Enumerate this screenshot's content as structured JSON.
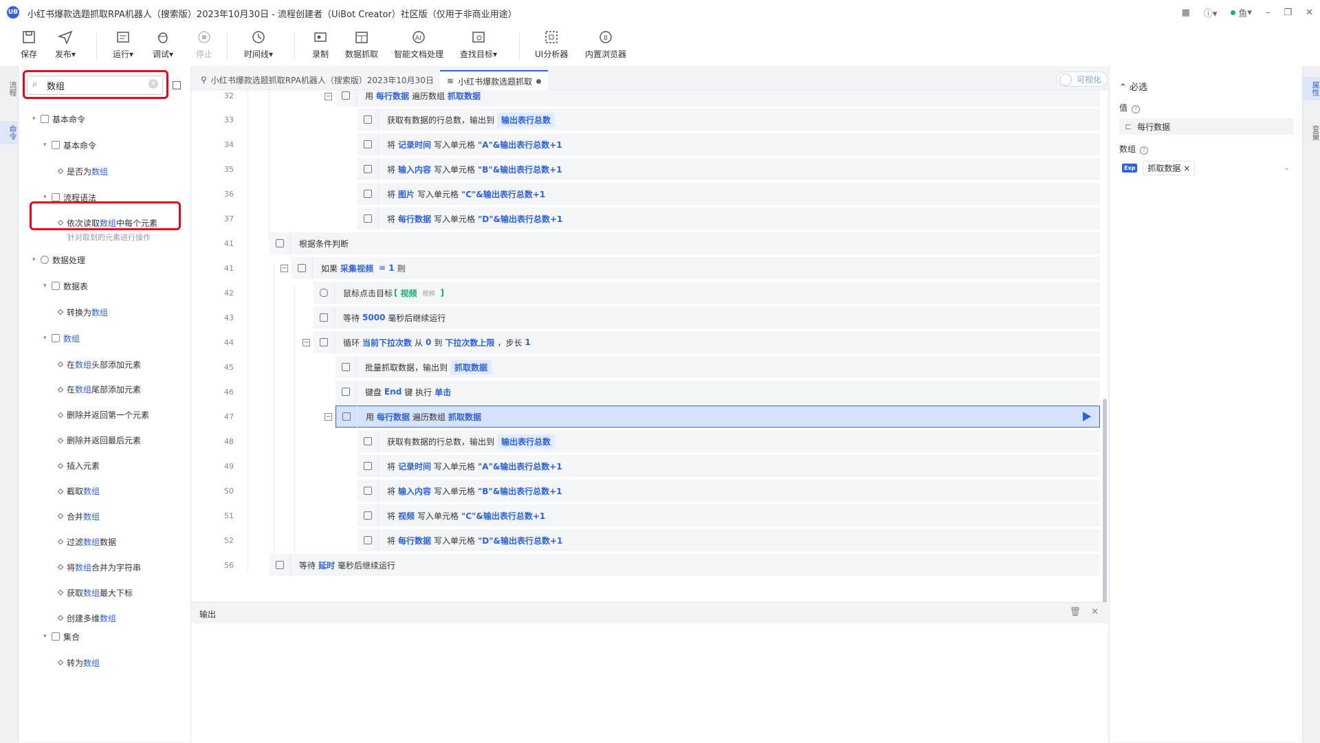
{
  "window": {
    "logo": "UB",
    "title": "小红书爆款选题抓取RPA机器人（搜索版）2023年10月30日 - 流程创建者（UiBot Creator）社区版（仅用于非商业用途）",
    "user": "鱼",
    "controls": {
      "minimize": "–",
      "restore": "❐",
      "close": "✕"
    }
  },
  "toolbar": {
    "save": "保存",
    "publish": "发布",
    "run": "运行",
    "debug": "调试",
    "stop": "停止",
    "timeline": "时间线",
    "record": "录制",
    "data_grab": "数据抓取",
    "smart_doc": "智能文档处理",
    "find_target": "查找目标",
    "ui_analyzer": "UI分析器",
    "browser": "内置浏览器",
    "dropdown_marker": "▾"
  },
  "left_rail": {
    "tab1": "流程",
    "tab2": "命令"
  },
  "search": {
    "value": "数组",
    "clear": "×"
  },
  "tree": {
    "basic_commands": "基本命令",
    "basic_commands_sub": "基本命令",
    "is_array_prefix": "是否为",
    "keyword": "数组",
    "flow_syntax": "流程语法",
    "foreach_prefix": "依次读取",
    "foreach_suffix": "中每个元素",
    "foreach_hint": "针对取到的元素进行操作",
    "data_processing": "数据处理",
    "datatable": "数据表",
    "convert_prefix": "转换为",
    "array_group": "数组",
    "items": [
      {
        "pre": "在",
        "post": "头部添加元素"
      },
      {
        "pre": "在",
        "post": "尾部添加元素"
      },
      {
        "pre": "删除并返回第一个元素",
        "post": ""
      },
      {
        "pre": "删除并返回最后元素",
        "post": ""
      },
      {
        "pre": "插入元素",
        "post": ""
      },
      {
        "pre": "截取",
        "post": ""
      },
      {
        "pre": "合并",
        "post": ""
      },
      {
        "pre": "过滤",
        "post": "数据"
      },
      {
        "pre": "将",
        "post": "合并为字符串"
      },
      {
        "pre": "获取",
        "post": "最大下标"
      },
      {
        "pre": "创建多维",
        "post": ""
      }
    ],
    "collection": "集合",
    "to_array_prefix": "转为"
  },
  "tabs": {
    "main_flow": "小红书爆款选题抓取RPA机器人（搜索版）2023年10月30日",
    "sub_flow": "小红书爆款选题抓取",
    "visualize": "可视化"
  },
  "code": {
    "lines": [
      "32",
      "33",
      "34",
      "35",
      "36",
      "37",
      "41",
      "41",
      "42",
      "43",
      "44",
      "45",
      "46",
      "47",
      "48",
      "49",
      "50",
      "51",
      "52",
      "56"
    ],
    "use": "用",
    "traverse": "遍历数组",
    "each_row": "每行数据",
    "grab_data": "抓取数据",
    "get_rows": "获取有数据的行总数，输出到",
    "total_rows": "输出表行总数",
    "write_prefix": "将",
    "write_mid": "写入单元格",
    "rec_time": "记录时间",
    "input_content": "输入内容",
    "image": "图片",
    "video_var": "视频",
    "cell_a": "\"A\"&输出表行总数+1",
    "cell_b": "\"B\"&输出表行总数+1",
    "cell_c": "\"C\"&输出表行总数+1",
    "cell_d": "\"D\"&输出表行总数+1",
    "cond_judge": "根据条件判断",
    "if_kw": "如果",
    "collect_video": "采集视频",
    "eq_one": "= 1",
    "then_kw": "则",
    "mouse_click": "鼠标点击目标",
    "bracket_open": "[",
    "target_video": "视频",
    "target_small": "视频",
    "bracket_close": "]",
    "wait_kw": "等待",
    "wait_ms": "5000",
    "wait_suffix": "毫秒后继续运行",
    "loop_kw": "循环",
    "cur_scroll": "当前下拉次数",
    "from_kw": "从",
    "zero": "0",
    "to_kw": "到",
    "scroll_max": "下拉次数上限",
    "step_kw": "，步长",
    "one": "1",
    "batch_grab": "批量抓取数据，输出到",
    "key_kw": "键盘",
    "end_key": "End",
    "key_exec": "键 执行",
    "single_click": "单击",
    "delay": "延时"
  },
  "output": {
    "title": "输出",
    "trash": "🗑",
    "close": "✕"
  },
  "props": {
    "section": "必选",
    "value_label": "值",
    "value_field": "每行数据",
    "data_label": "数组",
    "exp_badge": "Exp",
    "data_tag": "抓取数据",
    "tag_close": "×",
    "help": "?"
  },
  "right_rail": {
    "tab1": "属性",
    "tab2": "变量"
  }
}
